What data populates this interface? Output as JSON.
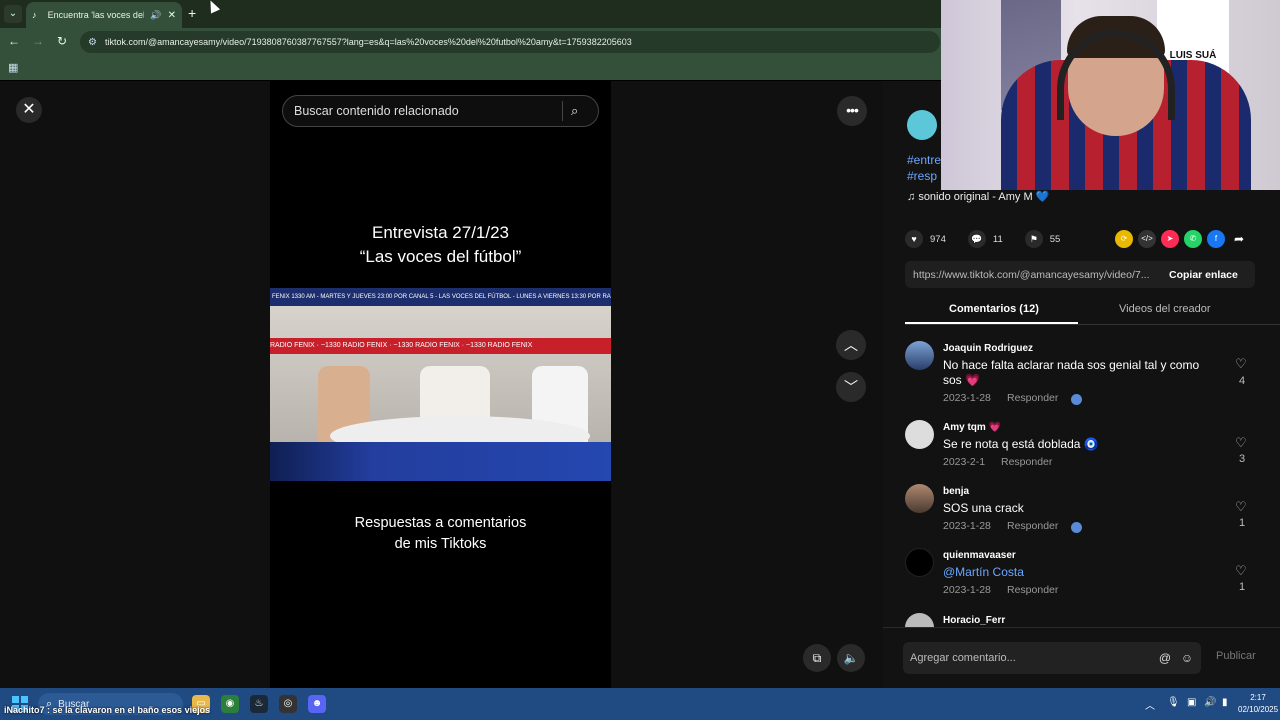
{
  "browser": {
    "tab_title": "Encuentra 'las voces del fútbol'",
    "new_tab_label": "+",
    "url": "tiktok.com/@amancayesamy/video/7193808760387767557?lang=es&q=las%20voces%20del%20futbol%20amy&t=1759382205603"
  },
  "search": {
    "placeholder": "Buscar contenido relacionado"
  },
  "video": {
    "title_line1": "Entrevista 27/1/23",
    "title_line2": "“Las voces del fútbol”",
    "ticker": "FENIX 1330 AM - MARTES Y JUEVES 23:00 POR CANAL 5 - LAS VOCES DEL FÚTBOL - LUNES A VIERNES 13:30 POR RADIO",
    "radio_banner": "RADIO FENIX · ~1330 RADIO FENIX · ~1330 RADIO FENIX · ~1330 RADIO FENIX",
    "subtitle_line1": "Respuestas a comentarios",
    "subtitle_line2": "de mis Tiktoks"
  },
  "sidebar": {
    "tags_line1": "#entre",
    "tags_line2": "#resp",
    "music": "sonido original - Amy M 💙",
    "likes": "974",
    "comments_count": "11",
    "saves": "55",
    "link": "https://www.tiktok.com/@amancayesamy/video/7...",
    "copy_link": "Copiar enlace",
    "tab_comments": "Comentarios (12)",
    "tab_creator": "Videos del creador"
  },
  "comments": [
    {
      "user": "Joaquin Rodriguez",
      "text": "No hace falta aclarar nada sos genial tal y como sos 💗",
      "date": "2023-1-28",
      "reply": "Responder",
      "likes": "4"
    },
    {
      "user": "Amy tqm 💗",
      "text": "Se re nota q está doblada 🧿",
      "date": "2023-2-1",
      "reply": "Responder",
      "likes": "3"
    },
    {
      "user": "benja",
      "text": "SOS una crack",
      "date": "2023-1-28",
      "reply": "Responder",
      "likes": "1"
    },
    {
      "user": "quienmavaaser",
      "text": "@Martín Costa",
      "date": "2023-1-28",
      "reply": "Responder",
      "likes": "1"
    },
    {
      "user": "Horacio_Ferr",
      "text": "",
      "date": "",
      "reply": "",
      "likes": ""
    }
  ],
  "compose": {
    "placeholder": "Agregar comentario...",
    "publish": "Publicar"
  },
  "webcam": {
    "poster_text": "LUIS SUÁ"
  },
  "taskbar": {
    "search_placeholder": "Buscar",
    "ticker": "iNachito7 : se la clavaron en el baño esos viejos",
    "time": "2:17",
    "date": "02/10/2025"
  },
  "colors": {
    "link_blue": "#6aa7ff",
    "taskbar": "#1f4a82",
    "chrome_green": "#34503a"
  }
}
